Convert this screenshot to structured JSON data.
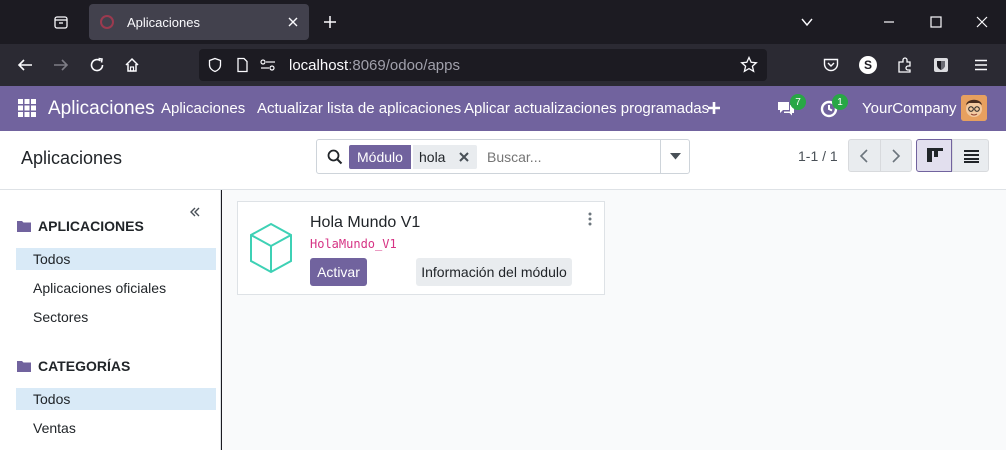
{
  "browser": {
    "tab_title": "Aplicaciones",
    "url_host": "localhost",
    "url_rest": ":8069/odoo/apps",
    "profile_initial": "S"
  },
  "odoo_nav": {
    "app_name": "Aplicaciones",
    "menu": [
      "Aplicaciones",
      "Actualizar lista de aplicaciones",
      "Aplicar actualizaciones programadas"
    ],
    "messages_count": "7",
    "activities_count": "1",
    "company": "YourCompany"
  },
  "control_panel": {
    "title": "Aplicaciones",
    "facet_label": "Módulo",
    "facet_value": "hola",
    "search_placeholder": "Buscar...",
    "pager": "1-1 / 1"
  },
  "sidebar": {
    "sections": [
      {
        "title": "APLICACIONES",
        "items": [
          {
            "label": "Todos",
            "active": true
          },
          {
            "label": "Aplicaciones oficiales",
            "active": false
          },
          {
            "label": "Sectores",
            "active": false
          }
        ]
      },
      {
        "title": "CATEGORÍAS",
        "items": [
          {
            "label": "Todos",
            "active": true
          },
          {
            "label": "Ventas",
            "active": false
          }
        ]
      }
    ]
  },
  "module_card": {
    "name": "Hola Mundo V1",
    "technical_name": "HolaMundo_V1",
    "activate_label": "Activar",
    "info_label": "Información del módulo",
    "icon": "cube-icon"
  },
  "colors": {
    "brand": "#71639e",
    "activate": "#71639e",
    "cube": "#3ed1b5",
    "badge": "#28a745",
    "technical_name": "#d63384"
  }
}
